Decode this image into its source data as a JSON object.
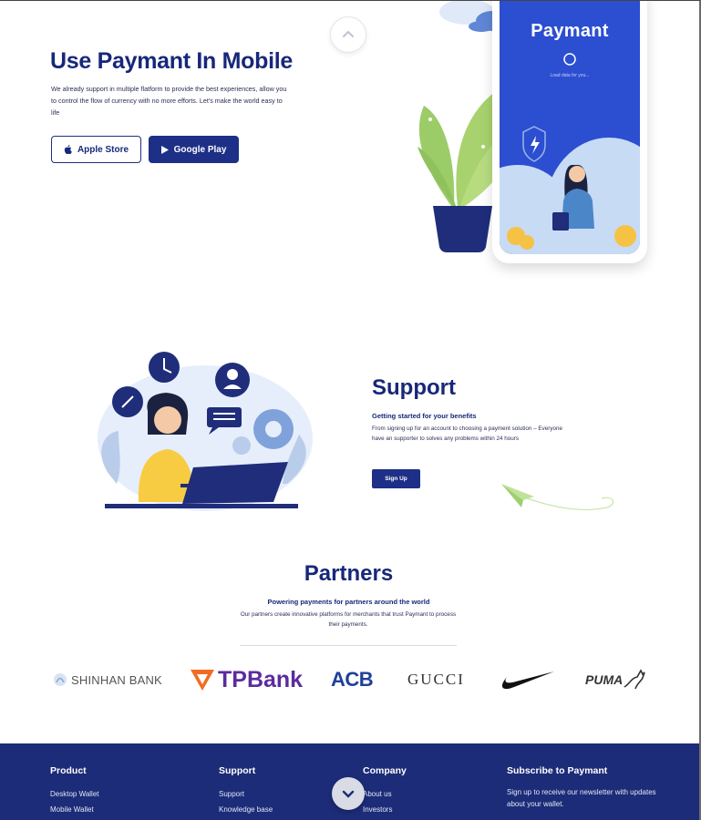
{
  "hero": {
    "title": "Use Paymant In Mobile",
    "description": "We already support in multiple flatform to provide the best experiences, allow you to control the flow of currency with no more efforts. Let's make the world easy to life",
    "apple_label": "Apple Store",
    "google_label": "Google Play"
  },
  "phone": {
    "brand": "Paymant",
    "loading": "Load data for you..."
  },
  "support": {
    "title": "Support",
    "subtitle": "Getting started for your benefits",
    "description": "From signing up for an account to choosing a payment solution – Everyone have an supporter to solves any problems within 24 hours",
    "signup_label": "Sign Up"
  },
  "partners": {
    "title": "Partners",
    "subtitle": "Powering payments for partners around the world",
    "description": "Our partners create innovative platforms for merchants that trust Paymant to process their payments.",
    "logos": {
      "shinhan": "SHINHAN BANK",
      "tpbank": "TPBank",
      "acb": "ACB",
      "gucci": "GUCCI",
      "nike": "Nike",
      "puma": "PUMA"
    }
  },
  "footer": {
    "product": {
      "heading": "Product",
      "links": [
        "Desktop Wallet",
        "Mobile Wallet"
      ]
    },
    "support": {
      "heading": "Support",
      "links": [
        "Support",
        "Knowledge base"
      ]
    },
    "company": {
      "heading": "Company",
      "links": [
        "About us",
        "Investors"
      ]
    },
    "subscribe": {
      "heading": "Subscribe to Paymant",
      "text": "Sign up to receive our newsletter with updates about your wallet."
    }
  },
  "colors": {
    "navy": "#17287a",
    "phone_blue": "#2c4ed0",
    "footer_bg": "#1c2c78"
  }
}
